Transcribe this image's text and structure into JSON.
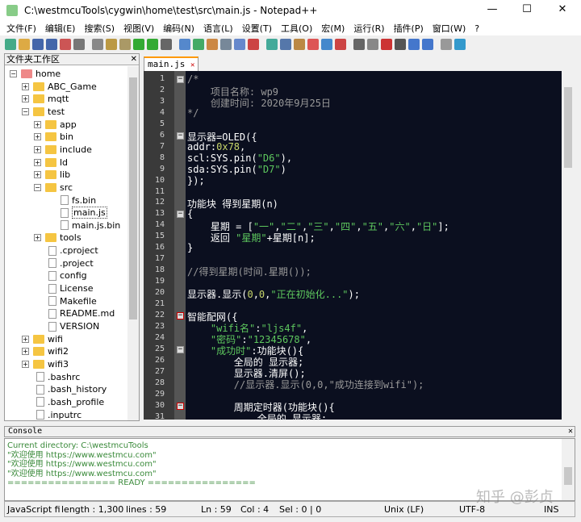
{
  "window": {
    "title": "C:\\westmcuTools\\cygwin\\home\\test\\src\\main.js - Notepad++",
    "min": "—",
    "max": "☐",
    "close": "✕"
  },
  "menu": [
    "文件(F)",
    "编辑(E)",
    "搜索(S)",
    "视图(V)",
    "编码(N)",
    "语言(L)",
    "设置(T)",
    "工具(O)",
    "宏(M)",
    "运行(R)",
    "插件(P)",
    "窗口(W)",
    "?"
  ],
  "toolbar_colors": [
    "#4a8",
    "#da4",
    "#46a",
    "#46a",
    "#c55",
    "#777",
    "#888",
    "#b94",
    "#a96",
    "#3a3",
    "#3a3",
    "#666",
    "#58c",
    "#4a6",
    "#c84",
    "#789",
    "#68c",
    "#c44",
    "#4a9",
    "#57a",
    "#b84",
    "#d55",
    "#48c",
    "#c44",
    "#666",
    "#888",
    "#c33",
    "#555",
    "#47c",
    "#47c",
    "#999",
    "#39c"
  ],
  "folder_panel": {
    "title": "文件夹工作区",
    "close": "✕",
    "tree": [
      {
        "label": "home",
        "depth": 0,
        "type": "root",
        "exp": "−"
      },
      {
        "label": "ABC_Game",
        "depth": 1,
        "type": "folder",
        "exp": "+"
      },
      {
        "label": "mqtt",
        "depth": 1,
        "type": "folder",
        "exp": "+"
      },
      {
        "label": "test",
        "depth": 1,
        "type": "folder",
        "exp": "−"
      },
      {
        "label": "app",
        "depth": 2,
        "type": "folder",
        "exp": "+"
      },
      {
        "label": "bin",
        "depth": 2,
        "type": "folder",
        "exp": "+"
      },
      {
        "label": "include",
        "depth": 2,
        "type": "folder",
        "exp": "+"
      },
      {
        "label": "ld",
        "depth": 2,
        "type": "folder",
        "exp": "+"
      },
      {
        "label": "lib",
        "depth": 2,
        "type": "folder",
        "exp": "+"
      },
      {
        "label": "src",
        "depth": 2,
        "type": "folder",
        "exp": "−"
      },
      {
        "label": "fs.bin",
        "depth": 3,
        "type": "file"
      },
      {
        "label": "main.js",
        "depth": 3,
        "type": "file",
        "selected": true
      },
      {
        "label": "main.js.bin",
        "depth": 3,
        "type": "file"
      },
      {
        "label": "tools",
        "depth": 2,
        "type": "folder",
        "exp": "+"
      },
      {
        "label": ".cproject",
        "depth": 2,
        "type": "file"
      },
      {
        "label": ".project",
        "depth": 2,
        "type": "file"
      },
      {
        "label": "config",
        "depth": 2,
        "type": "file"
      },
      {
        "label": "License",
        "depth": 2,
        "type": "file"
      },
      {
        "label": "Makefile",
        "depth": 2,
        "type": "file"
      },
      {
        "label": "README.md",
        "depth": 2,
        "type": "file"
      },
      {
        "label": "VERSION",
        "depth": 2,
        "type": "file"
      },
      {
        "label": "wifi",
        "depth": 1,
        "type": "folder",
        "exp": "+"
      },
      {
        "label": "wifi2",
        "depth": 1,
        "type": "folder",
        "exp": "+"
      },
      {
        "label": "wifi3",
        "depth": 1,
        "type": "folder",
        "exp": "+"
      },
      {
        "label": ".bashrc",
        "depth": 1,
        "type": "file"
      },
      {
        "label": ".bash_history",
        "depth": 1,
        "type": "file"
      },
      {
        "label": ".bash_profile",
        "depth": 1,
        "type": "file"
      },
      {
        "label": ".inputrc",
        "depth": 1,
        "type": "file"
      }
    ]
  },
  "editor": {
    "tab": "main.js",
    "tab_close": "✕",
    "lines": [
      [
        [
          "/*",
          "c"
        ]
      ],
      [
        [
          "    项目名称: wp9",
          "c"
        ]
      ],
      [
        [
          "    创建时间: 2020年9月25日",
          "c"
        ]
      ],
      [
        [
          "*/",
          "c"
        ]
      ],
      [],
      [
        [
          "显示器=OLED({",
          ""
        ]
      ],
      [
        [
          "addr:",
          ""
        ],
        [
          "0x78",
          "n"
        ],
        [
          ",",
          ""
        ]
      ],
      [
        [
          "scl:SYS.pin(",
          ""
        ],
        [
          "\"D6\"",
          "s"
        ],
        [
          "),",
          ""
        ]
      ],
      [
        [
          "sda:SYS.pin(",
          ""
        ],
        [
          "\"D7\"",
          "s"
        ],
        [
          ")",
          ""
        ]
      ],
      [
        [
          "});",
          ""
        ]
      ],
      [],
      [
        [
          "功能块 得到星期(n)",
          ""
        ]
      ],
      [
        [
          "{",
          ""
        ]
      ],
      [
        [
          "    星期 = [",
          ""
        ],
        [
          "\"一\"",
          "s"
        ],
        [
          ",",
          ""
        ],
        [
          "\"二\"",
          "s"
        ],
        [
          ",",
          ""
        ],
        [
          "\"三\"",
          "s"
        ],
        [
          ",",
          ""
        ],
        [
          "\"四\"",
          "s"
        ],
        [
          ",",
          ""
        ],
        [
          "\"五\"",
          "s"
        ],
        [
          ",",
          ""
        ],
        [
          "\"六\"",
          "s"
        ],
        [
          ",",
          ""
        ],
        [
          "\"日\"",
          "s"
        ],
        [
          "];",
          ""
        ]
      ],
      [
        [
          "    返回 ",
          ""
        ],
        [
          "\"星期\"",
          "s"
        ],
        [
          "+星期[n];",
          ""
        ]
      ],
      [
        [
          "}",
          ""
        ]
      ],
      [],
      [
        [
          "//得到星期(时间.星期());",
          "c"
        ]
      ],
      [],
      [
        [
          "显示器.显示(",
          ""
        ],
        [
          "0",
          "n"
        ],
        [
          ",",
          ""
        ],
        [
          "0",
          "n"
        ],
        [
          ",",
          ""
        ],
        [
          "\"正在初始化...\"",
          "s"
        ],
        [
          ");",
          ""
        ]
      ],
      [],
      [
        [
          "智能配网({",
          ""
        ]
      ],
      [
        [
          "    ",
          ""
        ],
        [
          "\"wifi名\"",
          "s"
        ],
        [
          ":",
          ""
        ],
        [
          "\"ljs4f\"",
          "s"
        ],
        [
          ",",
          ""
        ]
      ],
      [
        [
          "    ",
          ""
        ],
        [
          "\"密码\"",
          "s"
        ],
        [
          ":",
          ""
        ],
        [
          "\"12345678\"",
          "s"
        ],
        [
          ",",
          ""
        ]
      ],
      [
        [
          "    ",
          ""
        ],
        [
          "\"成功时\"",
          "s"
        ],
        [
          ":功能块(){",
          ""
        ]
      ],
      [
        [
          "        全局的 显示器;",
          ""
        ]
      ],
      [
        [
          "        显示器.清屏();",
          ""
        ]
      ],
      [
        [
          "        //显示器.显示(0,0,\"成功连接到wifi\");",
          "c"
        ]
      ],
      [],
      [
        [
          "        周期定时器(功能块(){",
          ""
        ]
      ],
      [
        [
          "            全局的 显示器;",
          ""
        ]
      ]
    ],
    "fold_markers": [
      {
        "line": 1,
        "red": false
      },
      {
        "line": 6,
        "red": false
      },
      {
        "line": 13,
        "red": false
      },
      {
        "line": 22,
        "red": true
      },
      {
        "line": 25,
        "red": false
      },
      {
        "line": 30,
        "red": true
      }
    ]
  },
  "console": {
    "title": "Console",
    "close": "✕",
    "lines": [
      "Current directory: C:\\westmcuTools",
      "\"欢迎使用 https://www.westmcu.com\"",
      "\"欢迎使用 https://www.westmcu.com\"",
      "\"欢迎使用 https://www.westmcu.com\"",
      "================ READY ================"
    ]
  },
  "status": {
    "type": "JavaScript fi",
    "length": "length : 1,300",
    "lines": "lines : 59",
    "ln": "Ln : 59",
    "col": "Col : 4",
    "sel": "Sel : 0 | 0",
    "eol": "Unix (LF)",
    "enc": "UTF-8",
    "mode": "INS"
  },
  "watermark": "知乎 @彭贞"
}
